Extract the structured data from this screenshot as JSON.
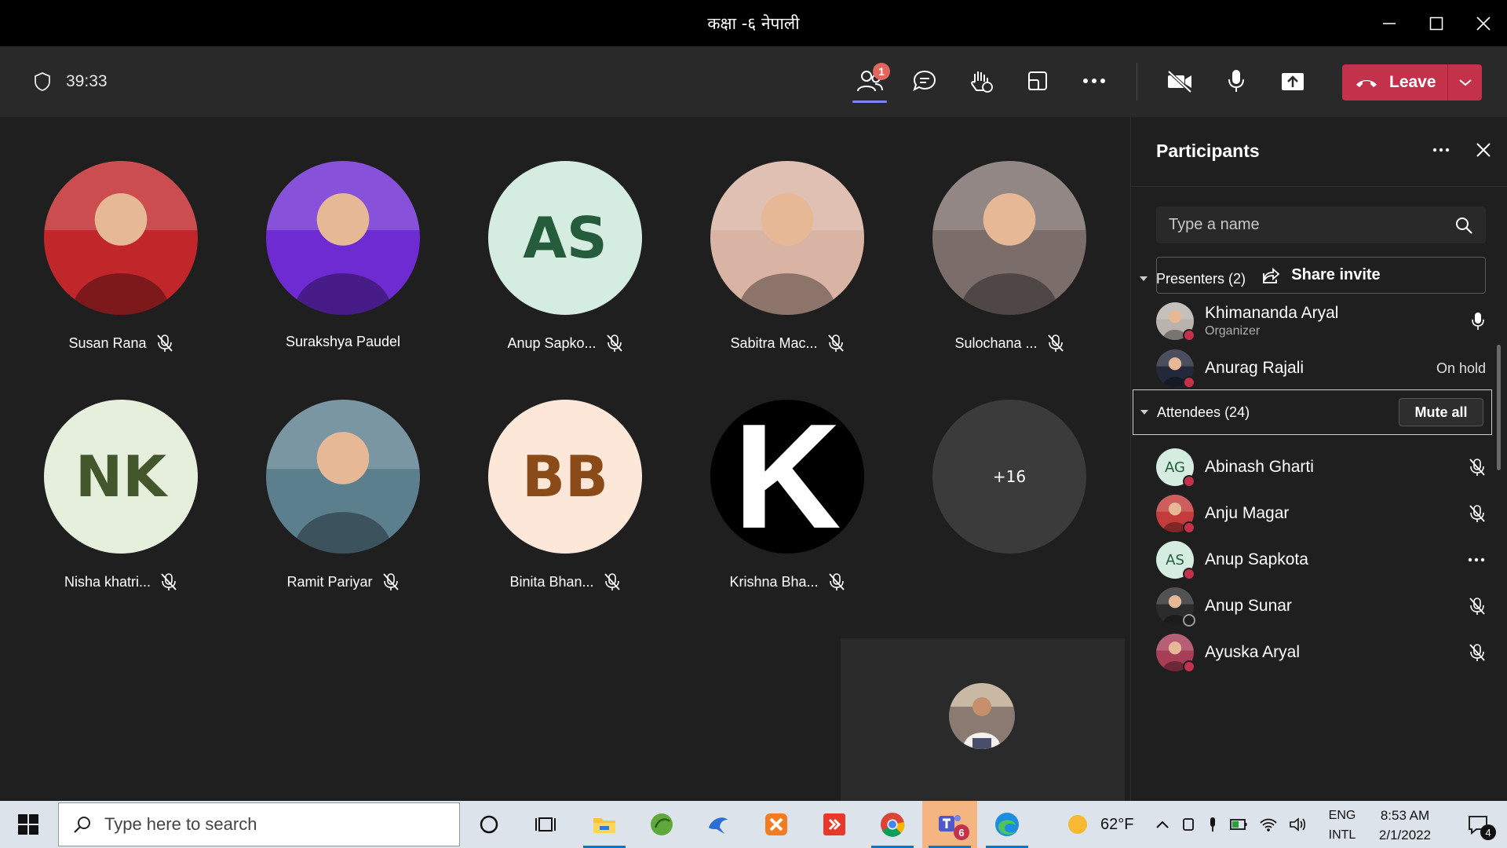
{
  "window": {
    "title": "कक्षा -६ नेपाली"
  },
  "toolbar": {
    "timer": "39:33",
    "participants_badge": "1",
    "leave_label": "Leave"
  },
  "tiles": [
    {
      "name": "Susan Rana",
      "type": "photo",
      "muted": true,
      "photo_color": "#c0262a"
    },
    {
      "name": "Surakshya Paudel",
      "type": "photo",
      "muted": false,
      "photo_color": "#6e2bd1"
    },
    {
      "name": "Anup Sapko...",
      "type": "initials",
      "initials": "AS",
      "muted": true,
      "bg": "#d4ede0",
      "fg": "#255d3c"
    },
    {
      "name": "Sabitra Mac...",
      "type": "photo",
      "muted": true,
      "photo_color": "#d9b3a3"
    },
    {
      "name": "Sulochana ...",
      "type": "photo",
      "muted": true,
      "photo_color": "#7a6d6a"
    },
    {
      "name": "Nisha khatri...",
      "type": "initials",
      "initials": "NK",
      "muted": true,
      "bg": "#e6eedc",
      "fg": "#44572c"
    },
    {
      "name": "Ramit Pariyar",
      "type": "photo",
      "muted": true,
      "photo_color": "#5c7f8e"
    },
    {
      "name": "Binita Bhan...",
      "type": "initials",
      "initials": "BB",
      "muted": true,
      "bg": "#fde7d8",
      "fg": "#8a4b18"
    },
    {
      "name": "Krishna Bha...",
      "type": "letter",
      "initials": "K",
      "muted": true,
      "bg": "#000000",
      "fg": "#ffffff"
    },
    {
      "name": "",
      "type": "overflow",
      "initials": "+16",
      "muted": false,
      "bg": "#3b3b3b",
      "fg": "#ffffff"
    }
  ],
  "panel": {
    "title": "Participants",
    "search_placeholder": "Type a name",
    "share_label": "Share invite",
    "presenters_label": "Presenters (2)",
    "attendees_label": "Attendees (24)",
    "mute_all_label": "Mute all",
    "presenters": [
      {
        "name": "Khimananda Aryal",
        "role": "Organizer",
        "status": "",
        "right": "mic"
      },
      {
        "name": "Anurag Rajali",
        "role": "",
        "status": "On hold",
        "right": ""
      }
    ],
    "attendees": [
      {
        "name": "Abinash Gharti",
        "initials": "AG",
        "right": "mic-off"
      },
      {
        "name": "Anju Magar",
        "initials": "",
        "right": "mic-off"
      },
      {
        "name": "Anup Sapkota",
        "initials": "AS",
        "right": "more"
      },
      {
        "name": "Anup Sunar",
        "initials": "",
        "right": "mic-off"
      },
      {
        "name": "Ayuska Aryal",
        "initials": "",
        "right": "mic-off"
      }
    ]
  },
  "taskbar": {
    "search_placeholder": "Type here to search",
    "teams_badge": "6",
    "weather": "62°F",
    "lang_top": "ENG",
    "lang_bottom": "INTL",
    "time": "8:53 AM",
    "date": "2/1/2022",
    "notifications": "4"
  }
}
